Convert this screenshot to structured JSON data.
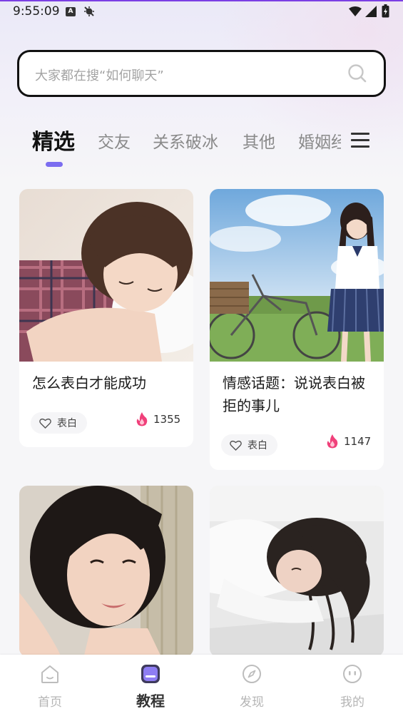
{
  "status_bar": {
    "time": "9:55:09",
    "notif_a": "A"
  },
  "search": {
    "placeholder": "大家都在搜“如何聊天”"
  },
  "tabs": [
    {
      "label": "精选",
      "active": true
    },
    {
      "label": "交友",
      "active": false
    },
    {
      "label": "关系破冰",
      "active": false
    },
    {
      "label": "其他",
      "active": false
    },
    {
      "label": "婚姻经",
      "active": false
    }
  ],
  "cards": [
    {
      "title": "怎么表白才能成功",
      "tag": "表白",
      "count": "1355"
    },
    {
      "title": "情感话题：说说表白被拒的事儿",
      "tag": "表白",
      "count": "1147"
    },
    {
      "title": "",
      "tag": "",
      "count": ""
    },
    {
      "title": "",
      "tag": "",
      "count": ""
    }
  ],
  "nav": [
    {
      "label": "首页",
      "icon": "home-icon",
      "active": false
    },
    {
      "label": "教程",
      "icon": "tutorial-icon",
      "active": true
    },
    {
      "label": "发现",
      "icon": "compass-icon",
      "active": false
    },
    {
      "label": "我的",
      "icon": "profile-face-icon",
      "active": false
    }
  ],
  "colors": {
    "accent": "#7b6df0",
    "fire": "#f0407a",
    "search_border": "#111111"
  }
}
